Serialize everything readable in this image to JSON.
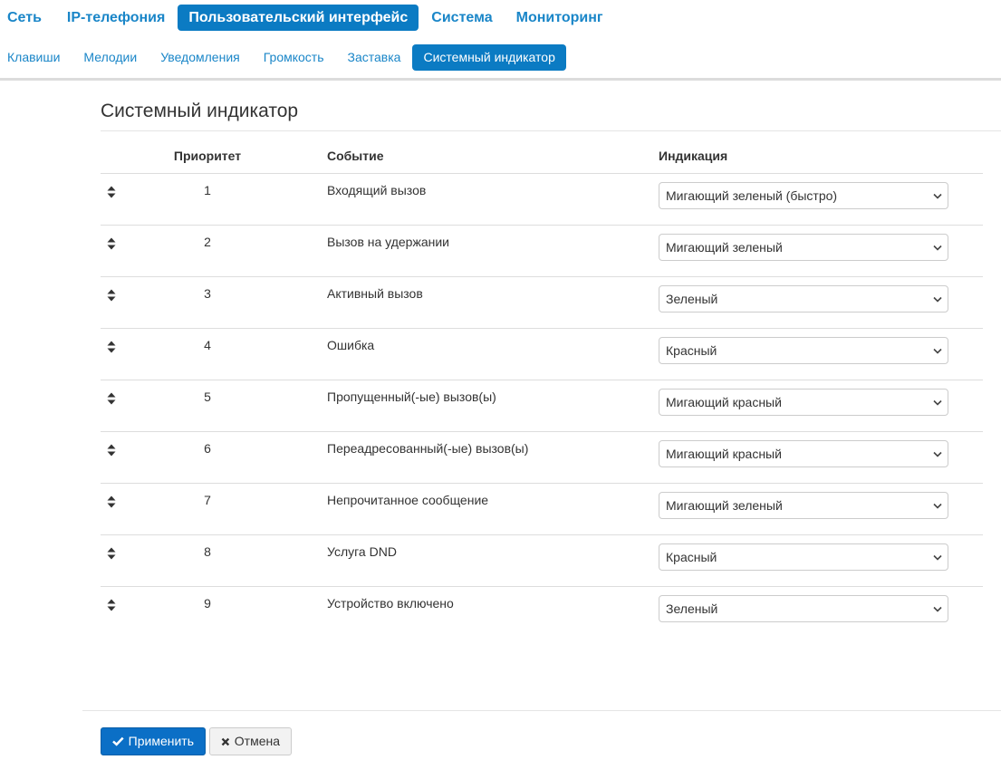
{
  "main_nav": [
    {
      "label": "Сеть",
      "active": false
    },
    {
      "label": "IP-телефония",
      "active": false
    },
    {
      "label": "Пользовательский интерфейс",
      "active": true
    },
    {
      "label": "Система",
      "active": false
    },
    {
      "label": "Мониторинг",
      "active": false
    }
  ],
  "sub_nav": [
    {
      "label": "Клавиши",
      "active": false
    },
    {
      "label": "Мелодии",
      "active": false
    },
    {
      "label": "Уведомления",
      "active": false
    },
    {
      "label": "Громкость",
      "active": false
    },
    {
      "label": "Заставка",
      "active": false
    },
    {
      "label": "Системный индикатор",
      "active": true
    }
  ],
  "page": {
    "title": "Системный индикатор"
  },
  "table": {
    "headers": {
      "priority": "Приоритет",
      "event": "Событие",
      "indication": "Индикация"
    },
    "rows": [
      {
        "priority": "1",
        "event": "Входящий вызов",
        "indication": "Мигающий зеленый (быстро)"
      },
      {
        "priority": "2",
        "event": "Вызов на удержании",
        "indication": "Мигающий зеленый"
      },
      {
        "priority": "3",
        "event": "Активный вызов",
        "indication": "Зеленый"
      },
      {
        "priority": "4",
        "event": "Ошибка",
        "indication": "Красный"
      },
      {
        "priority": "5",
        "event": "Пропущенный(-ые) вызов(ы)",
        "indication": "Мигающий красный"
      },
      {
        "priority": "6",
        "event": "Переадресованный(-ые) вызов(ы)",
        "indication": "Мигающий красный"
      },
      {
        "priority": "7",
        "event": "Непрочитанное сообщение",
        "indication": "Мигающий зеленый"
      },
      {
        "priority": "8",
        "event": "Услуга DND",
        "indication": "Красный"
      },
      {
        "priority": "9",
        "event": "Устройство включено",
        "indication": "Зеленый"
      }
    ]
  },
  "buttons": {
    "apply": "Применить",
    "cancel": "Отмена"
  },
  "icons": {
    "drag": "sort-arrows-icon",
    "select": "chevron-down-icon",
    "apply": "check-icon",
    "cancel": "close-icon"
  },
  "colors": {
    "accent": "#0b7bc3",
    "link": "#1a86c8",
    "apply_button": "#0b6fc6"
  }
}
